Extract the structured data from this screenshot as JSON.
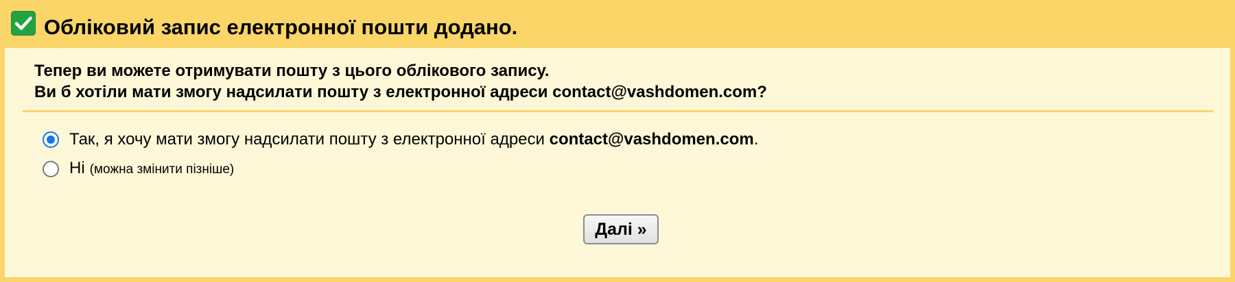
{
  "header": {
    "title": "Обліковий запис електронної пошти додано.",
    "icon": "checkmark-icon",
    "icon_color": "#23a243"
  },
  "panel": {
    "line1": "Тепер ви можете отримувати пошту з цього облікового запису.",
    "line2": "Ви б хотіли мати змогу надсилати пошту з електронної адреси contact@vashdomen.com?"
  },
  "options": {
    "yes_prefix": "Так, я хочу мати змогу надсилати пошту з електронної адреси ",
    "yes_email": "contact@vashdomen.com",
    "yes_suffix": ".",
    "no_label": "Ні",
    "no_note": "(можна змінити пізніше)",
    "selected": "yes"
  },
  "actions": {
    "next_label": "Далі »"
  },
  "colors": {
    "frame": "#fbd568",
    "panel": "#fff8d8",
    "radio_accent": "#1a73e8"
  }
}
